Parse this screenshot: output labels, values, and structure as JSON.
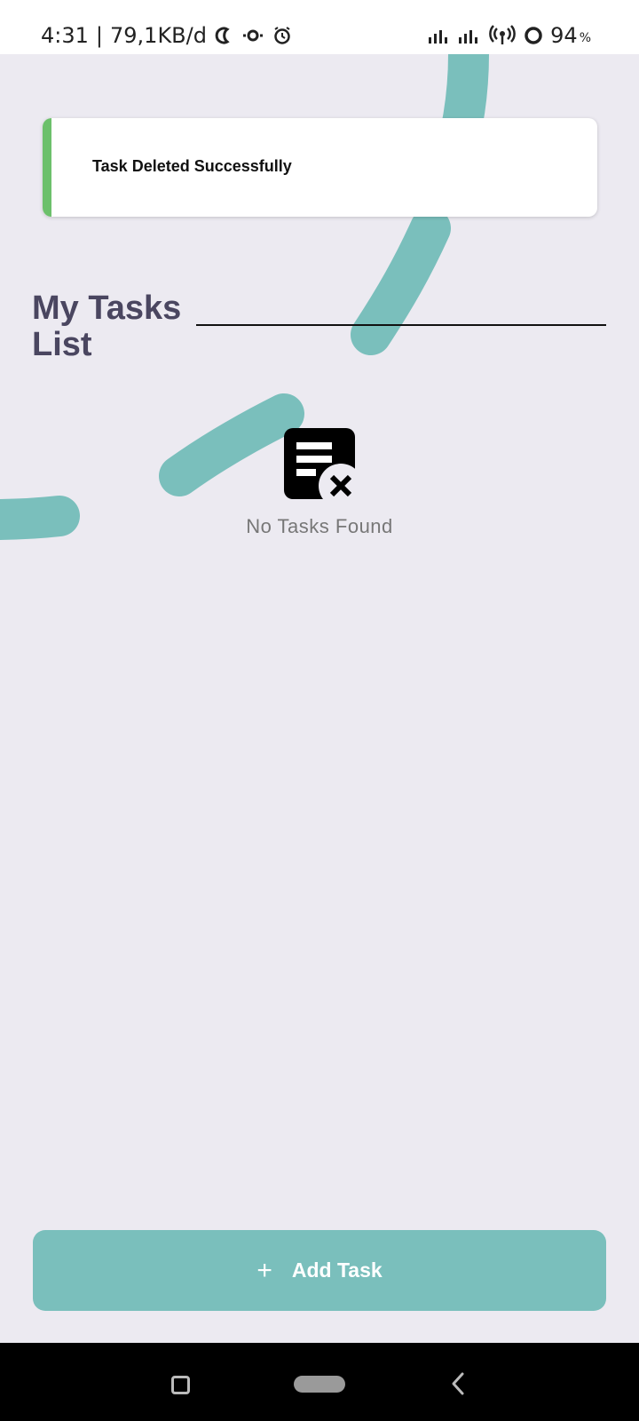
{
  "status_bar": {
    "time": "4:31",
    "separator": "|",
    "network_speed": "79,1KB/d",
    "battery_percent": "94",
    "battery_unit": "%"
  },
  "toast": {
    "message": "Task Deleted Successfully",
    "accent_color": "#6cc06b"
  },
  "header": {
    "title": "My Tasks List"
  },
  "empty_state": {
    "icon": "document-remove-icon",
    "message": "No Tasks Found"
  },
  "add_button": {
    "icon": "plus-icon",
    "label": "Add Task",
    "color": "#7abfbc"
  },
  "theme": {
    "background": "#eceaf1",
    "decoration": "#7abfbc",
    "title_color": "#4a4660"
  }
}
